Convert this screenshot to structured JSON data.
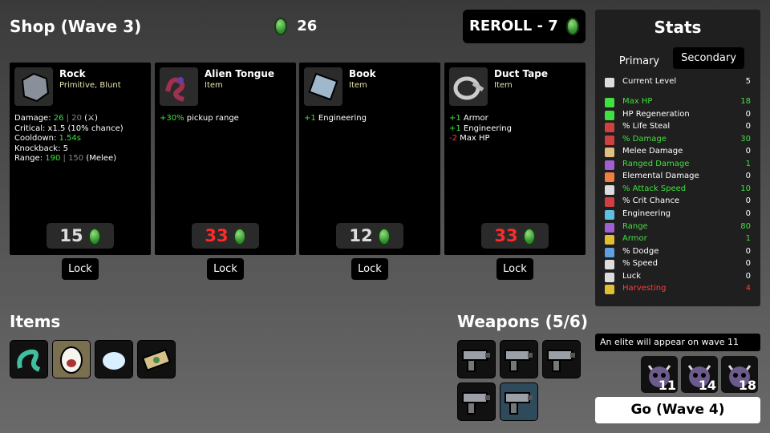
{
  "header": {
    "shop_title": "Shop (Wave 3)",
    "materials": "26",
    "reroll_label": "REROLL - 7"
  },
  "cards": [
    {
      "name": "Rock",
      "type": "Primitive, Blunt",
      "icon": "rock-icon",
      "stats": [
        [
          {
            "t": "Damage: "
          },
          {
            "t": "26",
            "c": "green"
          },
          {
            "t": " | 20 ",
            "c": "dim"
          },
          {
            "t": "(⚔)"
          }
        ],
        [
          {
            "t": "Critical: x1.5 (10% chance)"
          }
        ],
        [
          {
            "t": "Cooldown: "
          },
          {
            "t": "1.54s",
            "c": "green"
          }
        ],
        [
          {
            "t": "Knockback: 5"
          }
        ],
        [
          {
            "t": "Range: "
          },
          {
            "t": "190",
            "c": "green"
          },
          {
            "t": " | 150 ",
            "c": "dim"
          },
          {
            "t": "(Melee)"
          }
        ]
      ],
      "price": "15",
      "price_affordable": true,
      "lock": "Lock"
    },
    {
      "name": "Alien Tongue",
      "type": "Item",
      "icon": "alien-tongue-icon",
      "stats": [
        [
          {
            "t": "+30%",
            "c": "green"
          },
          {
            "t": " pickup range"
          }
        ]
      ],
      "price": "33",
      "price_affordable": false,
      "lock": "Lock"
    },
    {
      "name": "Book",
      "type": "Item",
      "icon": "book-icon",
      "stats": [
        [
          {
            "t": "+1",
            "c": "green"
          },
          {
            "t": " Engineering"
          }
        ]
      ],
      "price": "12",
      "price_affordable": true,
      "lock": "Lock"
    },
    {
      "name": "Duct Tape",
      "type": "Item",
      "icon": "duct-tape-icon",
      "stats": [
        [
          {
            "t": "+1",
            "c": "green"
          },
          {
            "t": " Armor"
          }
        ],
        [
          {
            "t": "+1",
            "c": "green"
          },
          {
            "t": " Engineering"
          }
        ],
        [
          {
            "t": "-2",
            "c": "red"
          },
          {
            "t": " Max HP"
          }
        ]
      ],
      "price": "33",
      "price_affordable": false,
      "lock": "Lock"
    }
  ],
  "items_section": {
    "title": "Items",
    "items": [
      "lizard-tail-icon",
      "egg-icon",
      "snowball-icon",
      "banknote-icon"
    ]
  },
  "weapons_section": {
    "title": "Weapons (5/6)",
    "weapons": [
      "gun-icon",
      "gun-icon",
      "gun-icon",
      "gun-icon",
      "gun-icon"
    ]
  },
  "stats": {
    "title": "Stats",
    "tab_primary": "Primary",
    "tab_secondary": "Secondary",
    "rows": [
      {
        "label": "Current Level",
        "value": "5",
        "color": "white",
        "icon": "level-icon"
      },
      {
        "label": "Max HP",
        "value": "18",
        "color": "green",
        "icon": "heart-icon"
      },
      {
        "label": "HP Regeneration",
        "value": "0",
        "color": "white",
        "icon": "regen-icon"
      },
      {
        "label": "% Life Steal",
        "value": "0",
        "color": "white",
        "icon": "life-steal-icon"
      },
      {
        "label": "% Damage",
        "value": "30",
        "color": "green",
        "icon": "damage-icon"
      },
      {
        "label": "Melee Damage",
        "value": "0",
        "color": "white",
        "icon": "melee-icon"
      },
      {
        "label": "Ranged Damage",
        "value": "1",
        "color": "green",
        "icon": "ranged-icon"
      },
      {
        "label": "Elemental Damage",
        "value": "0",
        "color": "white",
        "icon": "elemental-icon"
      },
      {
        "label": "% Attack Speed",
        "value": "10",
        "color": "green",
        "icon": "attack-speed-icon"
      },
      {
        "label": "% Crit Chance",
        "value": "0",
        "color": "white",
        "icon": "crit-icon"
      },
      {
        "label": "Engineering",
        "value": "0",
        "color": "white",
        "icon": "engineering-icon"
      },
      {
        "label": "Range",
        "value": "80",
        "color": "green",
        "icon": "range-icon"
      },
      {
        "label": "Armor",
        "value": "1",
        "color": "green",
        "icon": "armor-icon"
      },
      {
        "label": "% Dodge",
        "value": "0",
        "color": "white",
        "icon": "dodge-icon"
      },
      {
        "label": "% Speed",
        "value": "0",
        "color": "white",
        "icon": "speed-icon"
      },
      {
        "label": "Luck",
        "value": "0",
        "color": "white",
        "icon": "luck-icon"
      },
      {
        "label": "Harvesting",
        "value": "4",
        "color": "red",
        "icon": "harvesting-icon"
      }
    ]
  },
  "elite": {
    "notice": "An elite will appear on wave 11",
    "waves": [
      "11",
      "14",
      "18"
    ]
  },
  "go_label": "Go (Wave 4)",
  "colors": {
    "green": "#3fe03f",
    "red": "#ff3b3b",
    "price_red": "#ff2a2a"
  }
}
